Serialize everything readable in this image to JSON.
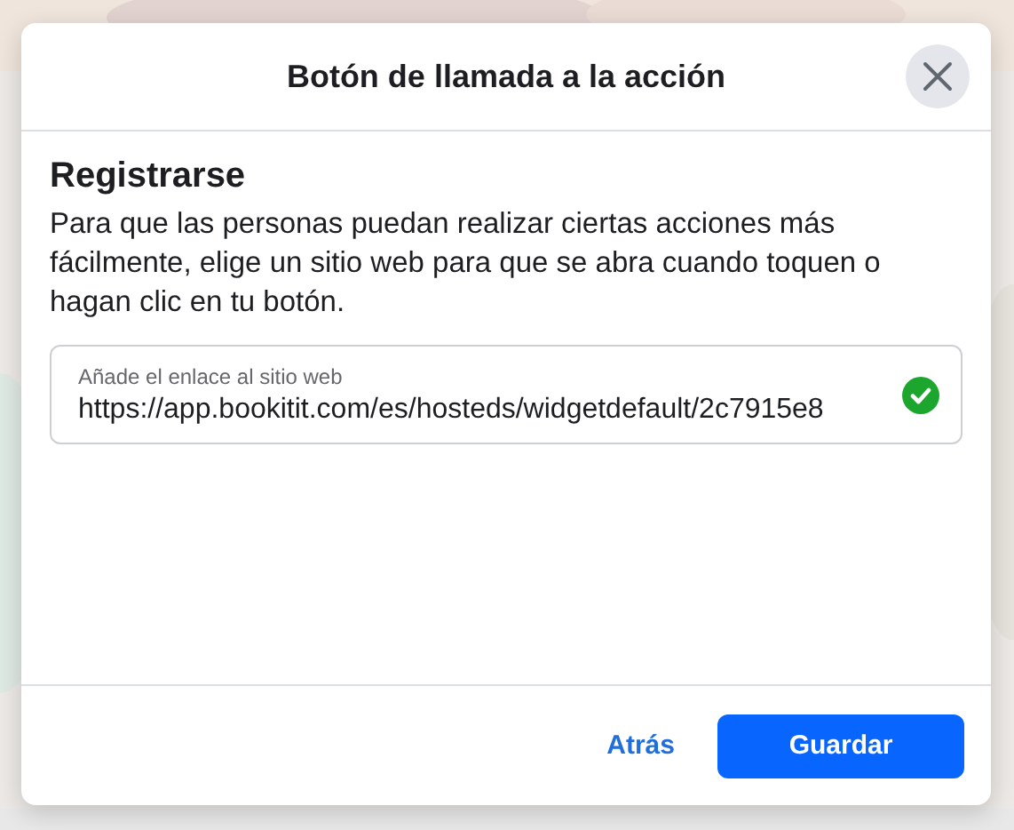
{
  "dialog": {
    "title": "Botón de llamada a la acción",
    "section_title": "Registrarse",
    "description": "Para que las personas puedan realizar ciertas acciones más fácilmente, elige un sitio web para que se abra cuando toquen o hagan clic en tu botón.",
    "field": {
      "label": "Añade el enlace al sitio web",
      "value": "https://app.bookitit.com/es/hosteds/widgetdefault/2c7915e8",
      "valid": true
    },
    "buttons": [
      {
        "label": "Atrás",
        "kind": "link"
      },
      {
        "label": "Guardar",
        "kind": "primary"
      }
    ]
  }
}
